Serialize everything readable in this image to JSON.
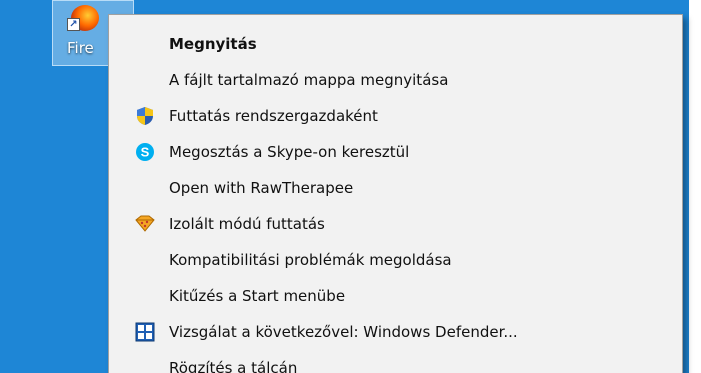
{
  "desktop": {
    "background_color": "#1e86d6",
    "icon": {
      "label": "Fire",
      "icon_name": "firefox-app-icon",
      "overlay": "shortcut-arrow-icon"
    }
  },
  "context_menu": {
    "items": [
      {
        "label": "Megnyitás",
        "icon": null,
        "default": true
      },
      {
        "label": "A fájlt tartalmazó mappa megnyitása",
        "icon": null
      },
      {
        "label": "Futtatás rendszergazdaként",
        "icon": "uac-shield-icon"
      },
      {
        "label": "Megosztás a Skype-on keresztül",
        "icon": "skype-icon"
      },
      {
        "label": "Open with RawTherapee",
        "icon": null
      },
      {
        "label": "Izolált módú futtatás",
        "icon": "sandbox-icon"
      },
      {
        "label": "Kompatibilitási problémák megoldása",
        "icon": null
      },
      {
        "label": "Kitűzés a Start menübe",
        "icon": null
      },
      {
        "label": "Vizsgálat a következővel: Windows Defender...",
        "icon": "windows-defender-icon"
      },
      {
        "label": "Rögzítés a tálcán",
        "icon": null
      }
    ]
  },
  "colors": {
    "menu_background": "#f2f2f2",
    "menu_border": "#a0a0a0",
    "skype_blue": "#00aff0",
    "shield_blue": "#2a5db0",
    "shield_yellow": "#f5c518",
    "defender_blue": "#1f5fb4"
  }
}
